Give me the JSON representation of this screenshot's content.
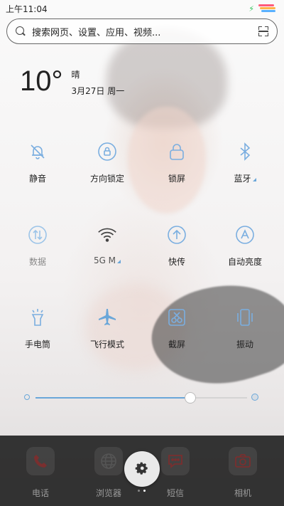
{
  "status_bar": {
    "time": "上午11:04"
  },
  "search": {
    "placeholder": "搜索网页、设置、应用、视频..."
  },
  "weather": {
    "temperature": "10°",
    "condition": "晴",
    "date": "3月27日 周一"
  },
  "toggles": [
    {
      "label": "静音",
      "icon": "bell-off-icon"
    },
    {
      "label": "方向锁定",
      "icon": "rotation-lock-icon"
    },
    {
      "label": "锁屏",
      "icon": "lock-icon"
    },
    {
      "label": "蓝牙",
      "icon": "bluetooth-icon"
    },
    {
      "label": "数据",
      "icon": "data-icon"
    },
    {
      "label": "5G M",
      "icon": "wifi-icon"
    },
    {
      "label": "快传",
      "icon": "quick-transfer-icon"
    },
    {
      "label": "自动亮度",
      "icon": "auto-brightness-icon"
    },
    {
      "label": "手电筒",
      "icon": "flashlight-icon"
    },
    {
      "label": "飞行模式",
      "icon": "airplane-icon"
    },
    {
      "label": "截屏",
      "icon": "screenshot-icon"
    },
    {
      "label": "振动",
      "icon": "vibrate-icon"
    }
  ],
  "brightness": {
    "level": 0.73
  },
  "dock": [
    {
      "label": "电话",
      "icon": "phone-icon"
    },
    {
      "label": "浏览器",
      "icon": "browser-icon"
    },
    {
      "label": "短信",
      "icon": "message-icon"
    },
    {
      "label": "相机",
      "icon": "camera-icon"
    }
  ],
  "colors": {
    "accent": "#6aa7d9",
    "dock_bg": "#141414"
  }
}
